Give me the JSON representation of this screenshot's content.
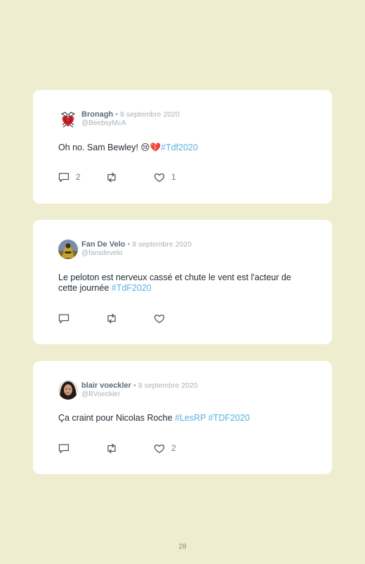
{
  "tweets": [
    {
      "name": "Bronagh",
      "dot": "•",
      "date": "8 septembre 2020",
      "handle": "@BeebsyMcA",
      "text": "Oh no. Sam Bewley! 😢💔",
      "hashtags": [
        "#Tdf2020"
      ],
      "reply_count": "2",
      "like_count": "1"
    },
    {
      "name": "Fan De Velo",
      "dot": "•",
      "date": "8 septembre 2020",
      "handle": "@fansdevelo",
      "text_line1": "Le peloton est nerveux cassé et chute le vent est l'acteur de",
      "text_line2": "cette journée",
      "hashtags": [
        "#TdF2020"
      ]
    },
    {
      "name": "blair voeckler",
      "dot": "•",
      "date": "8 septembre 2020",
      "handle": "@BVoeckler",
      "text": "Ça craint pour Nicolas Roche",
      "hashtags": [
        "#LesRP",
        "#TDF2020"
      ],
      "like_count": "2"
    }
  ],
  "page_number": "28",
  "colors": {
    "background": "#efedd0",
    "card": "#ffffff",
    "hashtag": "#57b0e0",
    "name": "#5a6b7c",
    "muted": "#a9b1b9"
  },
  "icons": [
    "reply-icon",
    "retweet-icon",
    "like-icon"
  ]
}
